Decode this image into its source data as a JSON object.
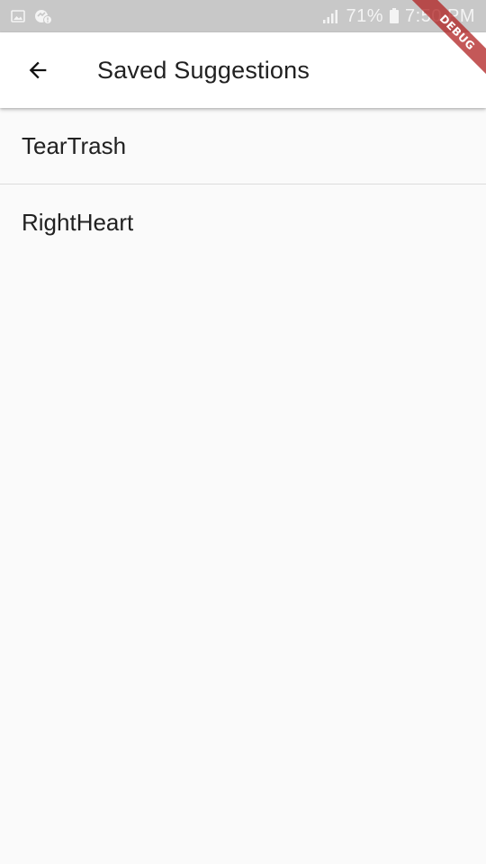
{
  "status_bar": {
    "battery_percent": "71%",
    "time": "7:50 PM",
    "icons": [
      "image-icon",
      "notification-icon",
      "signal-icon",
      "battery-icon"
    ],
    "background": "#c8c8c8"
  },
  "app_bar": {
    "title": "Saved Suggestions",
    "back_icon": "back-arrow-icon"
  },
  "list": {
    "items": [
      {
        "label": "TearTrash"
      },
      {
        "label": "RightHeart"
      }
    ]
  },
  "debug_banner": {
    "label": "DEBUG",
    "color": "#b02020"
  }
}
